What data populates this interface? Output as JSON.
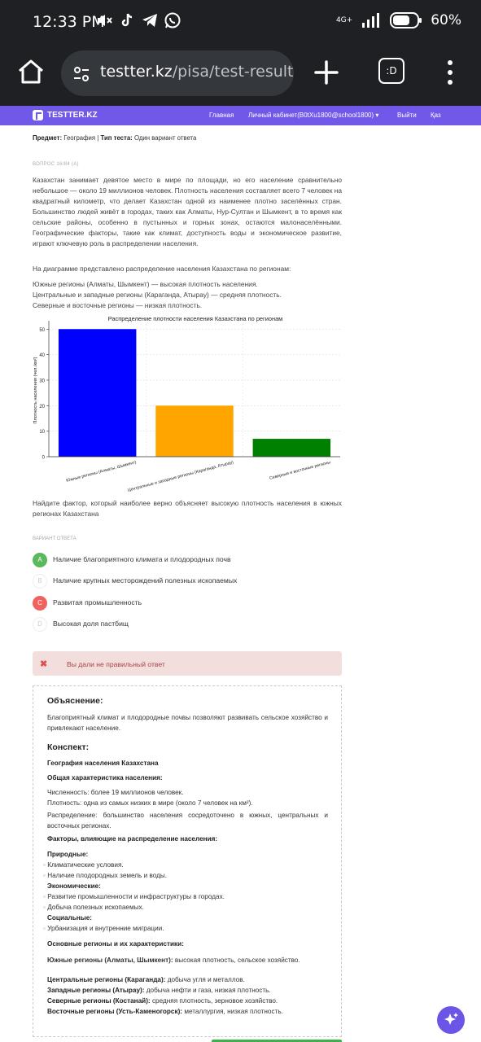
{
  "status_bar": {
    "time": "12:33 PM",
    "network": "4G+",
    "battery": "60%"
  },
  "browser": {
    "url_host": "testter.kz",
    "url_path": "/pisa/test-result/s",
    "tabs_icon_text": ":D"
  },
  "nav": {
    "logo": "TESTTER.KZ",
    "home": "Главная",
    "cabinet": "Личный кабинет(B0tXu1800@school1800) ▾",
    "logout": "Выйти",
    "lang": "Қаз"
  },
  "meta": {
    "subject_label": "Предмет:",
    "subject": "География",
    "type_label": "Тип теста:",
    "type": "Один вариант ответа"
  },
  "question": {
    "number": "ВОПРОС 16/84 (A)",
    "intro": "Казахстан занимает девятое место в мире по площади, но его население сравнительно небольшое — около 19 миллионов человек. Плотность населения составляет всего 7 человек на квадратный километр, что делает Казахстан одной из наименее плотно заселённых стран. Большинство людей живёт в городах, таких как Алматы, Нур-Султан и Шымкент, в то время как сельские районы, особенно в пустынных и горных зонах, остаются малонаселёнными. Географические факторы, такие как климат, доступность воды и экономическое развитие, играют ключевую роль в распределении населения.",
    "diagram_intro": "На диаграмме представлено распределение населения Казахстана по регионам:",
    "regions": [
      "Южные регионы (Алматы, Шымкент) — высокая плотность населения.",
      "Центральные и западные регионы (Караганда, Атырау) — средняя плотность.",
      "Северные и восточные регионы — низкая плотность."
    ],
    "prompt": "Найдите фактор, который наиболее верно объясняет высокую плотность населения в южных регионах Казахстана"
  },
  "chart_data": {
    "type": "bar",
    "title": "Распределение плотности населения Казахстана по регионам",
    "ylabel": "Плотность населения (чел./км²)",
    "xlabel": "",
    "categories": [
      "Южные регионы (Алматы, Шымкент)",
      "Центральные и западные регионы (Караганда, Атырау)",
      "Северные и восточные регионы"
    ],
    "values": [
      50,
      20,
      7
    ],
    "colors": [
      "#0000ff",
      "#ffa500",
      "#008000"
    ],
    "ylim": [
      0,
      52
    ],
    "yticks": [
      "0",
      "10",
      "20",
      "30",
      "40",
      "50"
    ],
    "grid": true
  },
  "options": {
    "label": "ВАРИАНТ ОТВЕТА",
    "items": [
      {
        "letter": "A",
        "text": "Наличие благоприятного климата и плодородных почв",
        "state": "correct",
        "color": "#5cb85c"
      },
      {
        "letter": "B",
        "text": "Наличие крупных месторождений полезных ископаемых",
        "state": "neutral",
        "color": "#ffffff"
      },
      {
        "letter": "C",
        "text": "Развитая промышленность",
        "state": "wrong",
        "color": "#f0625f"
      },
      {
        "letter": "D",
        "text": "Высокая доля пастбищ",
        "state": "neutral",
        "color": "#ffffff"
      }
    ]
  },
  "feedback": {
    "text": "Вы дали не правильный ответ"
  },
  "explanation": {
    "title": "Объяснение:",
    "text": "Благоприятный климат и плодородные почвы позволяют развивать сельское хозяйство и привлекают население.",
    "summary_title": "Конспект:",
    "topic": "География населения Казахстана",
    "general_title": "Общая характеристика населения:",
    "general_lines": [
      "Численность: более 19 миллионов человек.",
      "Плотность: одна из самых низких в мире (около 7 человек на км²).",
      "Распределение: большинство населения сосредоточено в южных, центральных и восточных регионах."
    ],
    "factors_title": "Факторы, влияющие на распределение населения:",
    "natural_title": "Природные:",
    "natural": [
      "Климатические условия.",
      "Наличие плодородных земель и воды."
    ],
    "economic_title": "Экономические:",
    "economic": [
      "Развитие промышленности и инфраструктуры в городах.",
      "Добыча полезных ископаемых."
    ],
    "social_title": "Социальные:",
    "social": [
      "Урбанизация и внутренние миграции."
    ],
    "regions_title": "Основные регионы и их характеристики:",
    "regions": [
      {
        "name": "Южные регионы (Алматы, Шымкент):",
        "desc": "высокая плотность, сельское хозяйство."
      },
      {
        "name": "Центральные регионы (Караганда):",
        "desc": "добыча угля и металлов."
      },
      {
        "name": "Западные регионы (Атырау):",
        "desc": "добыча нефти и газа, низкая плотность."
      },
      {
        "name": "Северные регионы (Костанай):",
        "desc": "средняя плотность, зерновое хозяйство."
      },
      {
        "name": "Восточные регионы (Усть-Каменогорск):",
        "desc": "металлургия, низкая плотность."
      }
    ]
  }
}
